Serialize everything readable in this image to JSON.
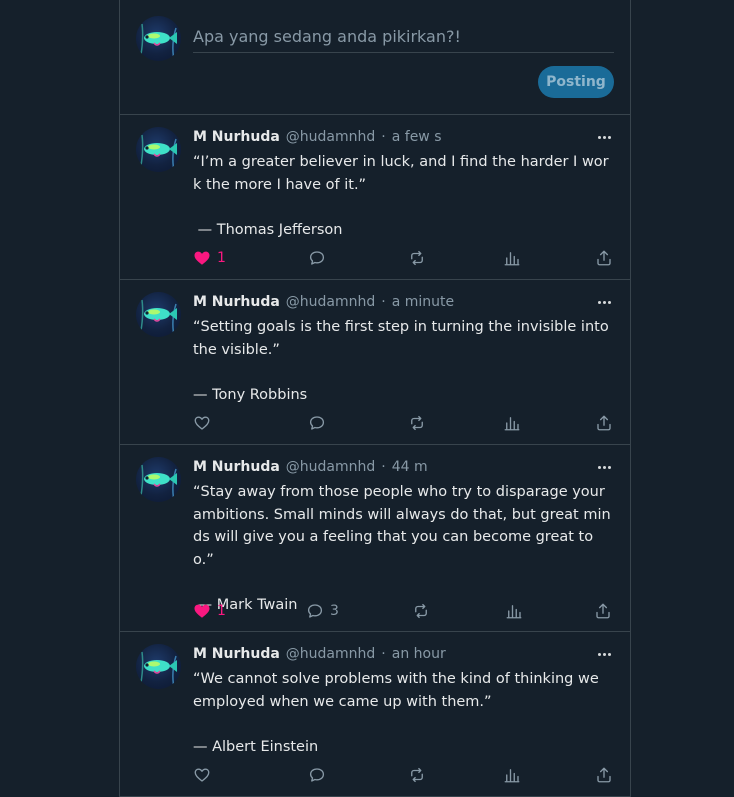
{
  "composer": {
    "placeholder": "Apa yang sedang anda pikirkan?!",
    "post_label": "Posting"
  },
  "tweets": [
    {
      "name": "M Nurhuda",
      "handle": "@hudamnhd",
      "separator": "·",
      "time": "a few s",
      "text": "“I’m a greater believer in luck, and I find the harder I work the more I have of it.”\n\n — Thomas Jefferson",
      "liked": true,
      "likes": "1",
      "replies": ""
    },
    {
      "name": "M Nurhuda",
      "handle": "@hudamnhd",
      "separator": "·",
      "time": "a minute",
      "text": "“Setting goals is the first step in turning the invisible into the visible.”\n\n— Tony Robbins",
      "liked": false,
      "likes": "",
      "replies": ""
    },
    {
      "name": "M Nurhuda",
      "handle": "@hudamnhd",
      "separator": "·",
      "time": "44 m",
      "text": "“Stay away from those people who try to disparage your ambitions. Small minds will always do that, but great minds will give you a feeling that you can become great too.”\n\n — Mark Twain",
      "liked": true,
      "likes": "1",
      "replies": "3"
    },
    {
      "name": "M Nurhuda",
      "handle": "@hudamnhd",
      "separator": "·",
      "time": "an hour",
      "text": "“We cannot solve problems with the kind of thinking we employed when we came up with them.”\n\n— Albert Einstein",
      "liked": false,
      "likes": "",
      "replies": ""
    }
  ],
  "colors": {
    "background": "#15202b",
    "border": "#38444d",
    "accent": "#1a6b98",
    "like": "#f91880",
    "muted": "#8899a6"
  },
  "icons": [
    "heart-icon",
    "reply-icon",
    "retweet-icon",
    "views-icon",
    "share-icon",
    "more-icon"
  ]
}
